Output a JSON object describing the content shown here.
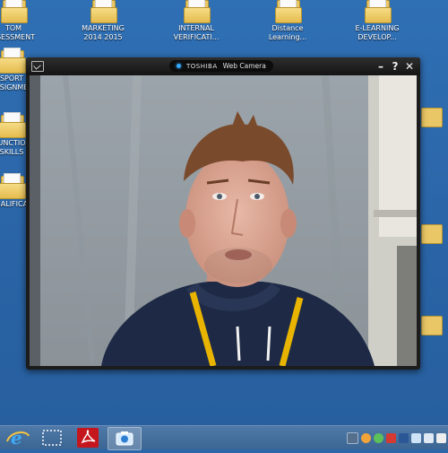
{
  "desktop": {
    "top_icons": [
      {
        "line1": "TOM",
        "line2": "SSESSMENT"
      },
      {
        "line1": "MARKETING",
        "line2": "2014 2015"
      },
      {
        "line1": "INTERNAL",
        "line2": "VERIFICATI..."
      },
      {
        "line1": "Distance",
        "line2": "Learning..."
      },
      {
        "line1": "E-LEARNING",
        "line2": "DEVELOP..."
      }
    ],
    "left_icons": [
      {
        "line1": "SPORT",
        "line2": "SSIGNME"
      },
      {
        "line1": "UNCTIO",
        "line2": "SKILLS"
      },
      {
        "line1": "UALIFICA",
        "line2": ""
      }
    ]
  },
  "camera_window": {
    "brand": "TOSHIBA",
    "title": "Web Camera",
    "minimize_glyph": "–",
    "help_glyph": "?",
    "close_glyph": "✕"
  },
  "taskbar": {
    "items": [
      "internet-explorer-icon",
      "snipping-tool-icon",
      "adobe-reader-icon",
      "web-camera-icon"
    ],
    "tray_icons": [
      "app-tray-icon",
      "orange-tray-icon",
      "sync-tray-icon",
      "red-tray-icon",
      "word-tray-icon",
      "wifi-tray-icon",
      "flag-tray-icon",
      "volume-tray-icon"
    ]
  },
  "colors": {
    "desktop_bg": "#2a66a8",
    "camera_accent": "#35a8ff"
  }
}
